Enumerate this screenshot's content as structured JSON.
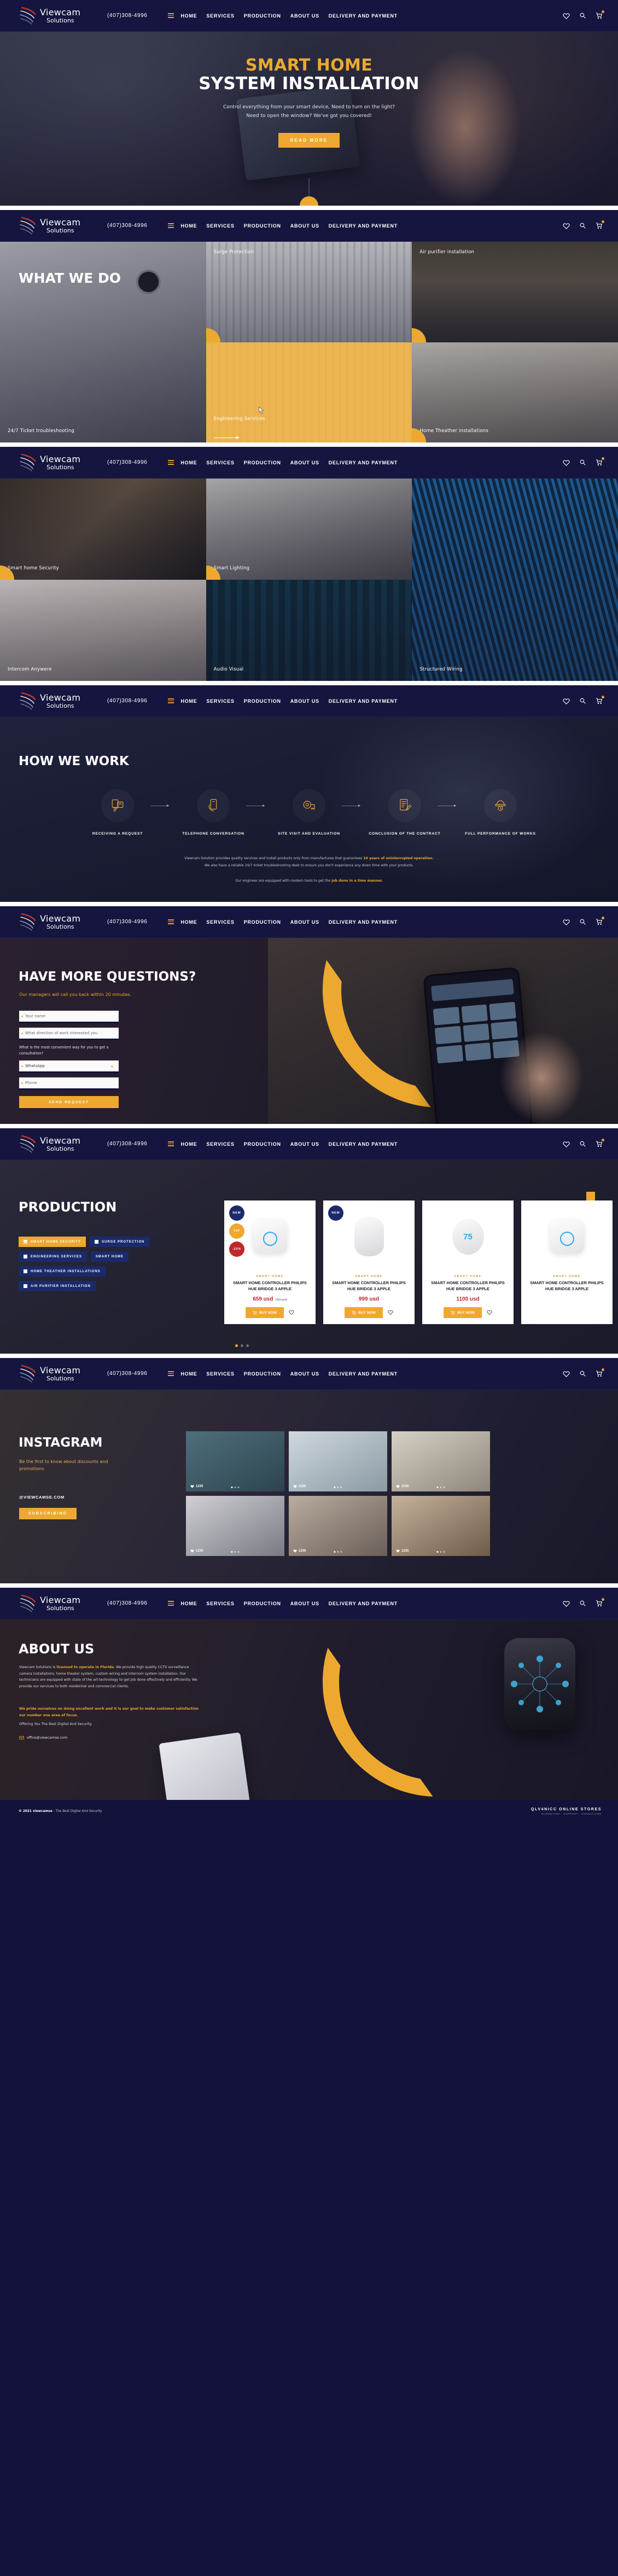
{
  "brand": {
    "name": "Viewcam",
    "tagline": "Solutions",
    "phone": "(407)308-4996"
  },
  "nav": {
    "links": [
      "HOME",
      "SERVICES",
      "PRODUCTION",
      "ABOUT US",
      "DELIVERY AND PAYMENT"
    ],
    "icons": [
      "heart-icon",
      "search-icon",
      "cart-icon"
    ]
  },
  "hero": {
    "title_accent": "SMART HOME",
    "title_main": "SYSTEM INSTALLATION",
    "sub_line1": "Control everything from your smart device, Need to turn on the light?",
    "sub_line2": "Need to open the window? We've got you covered!",
    "cta": "READ MORE"
  },
  "what_we_do": {
    "title": "WHAT WE DO",
    "tiles": [
      {
        "label": "24/7 Ticket troubleshooting",
        "active": false
      },
      {
        "label": "Surge Protection",
        "active": false
      },
      {
        "label": "Air purifier installation",
        "active": false
      },
      {
        "label": "Engineering Services",
        "active": true
      },
      {
        "label": "Home Theather installations",
        "active": false
      }
    ]
  },
  "gallery2": {
    "tiles": [
      {
        "label": "Smart home Security"
      },
      {
        "label": "Smart Lighting"
      },
      {
        "label": "Structured Wiring"
      },
      {
        "label": "Intercom Anywere"
      },
      {
        "label": "Audio Visual"
      }
    ]
  },
  "how_we_work": {
    "title": "HOW WE WORK",
    "steps": [
      {
        "label": "RECEIVING A REQUEST",
        "icon": "request-form-icon"
      },
      {
        "label": "TELEPHONE CONVERSATION",
        "icon": "phone-hand-icon"
      },
      {
        "label": "SITE VISIT AND EVALUATION",
        "icon": "tape-measure-icon"
      },
      {
        "label": "CONCLUSION OF THE CONTRACT",
        "icon": "contract-pen-icon"
      },
      {
        "label": "FULL PERFORMANCE OF WORKS",
        "icon": "engineer-icon"
      }
    ],
    "note1_a": "Viewcam Solution provides quality services and install products only from manufactures that guarantees ",
    "note1_hl": "10 years of uninterrupted operation.",
    "note2": "We also have a reliable 24/7 ticket troubleshooting desk to ensure you don't experiance any down time with your products.",
    "note3_a": "Our engineer are equipped with modern tools to get the ",
    "note3_hl": "job done in a time manner."
  },
  "questions": {
    "title": "HAVE MORE QUESTIONS?",
    "subtitle": "Our managers will call you back within 20 minutes.",
    "field_name_placeholder": "Your name",
    "field_direction_placeholder": "What direction of work interested you",
    "consult_question": "What is the most convenient way for you to get a consultation?",
    "select_value": "WhatsApp",
    "field_phone_placeholder": "Phone",
    "submit": "SEND REQUEST"
  },
  "production": {
    "title": "PRODUCTION",
    "filters": [
      {
        "label": "SMART HOME SECURITY",
        "checked": true
      },
      {
        "label": "SURGE PROTECTION",
        "checked": false
      },
      {
        "label": "ENGINEERING SERVICES",
        "checked": false
      },
      {
        "label": "SMART HOME",
        "checked": false
      },
      {
        "label": "HOME THEATHER INSTALLATIONS",
        "checked": false
      },
      {
        "label": "AIR PURIFIER INSTALLATION",
        "checked": false
      }
    ],
    "badges": [
      "NEW",
      "VIP",
      "-20%"
    ],
    "buy_label": "BUY NOW",
    "cards": [
      {
        "category": "SMART HOME",
        "name": "SMART HOME CONTROLLER PHILIPS HUE BRIDGE 3 APPLE",
        "price": "659 usd",
        "old_price": "750 usd",
        "badges": [
          "NEW",
          "VIP",
          "-20%"
        ],
        "device": "hub"
      },
      {
        "category": "SMART HOME",
        "name": "SMART HOME CONTROLLER PHILIPS HUE BRIDGE 3 APPLE",
        "price": "999 usd",
        "old_price": "",
        "badges": [
          "NEW"
        ],
        "device": "speaker"
      },
      {
        "category": "SMART HOME",
        "name": "SMART HOME CONTROLLER PHILIPS HUE BRIDGE 3 APPLE",
        "price": "1100 usd",
        "old_price": "",
        "badges": [],
        "device": "nest"
      },
      {
        "category": "SMART HOME",
        "name": "SMART HOME CONTROLLER PHILIPS HUE BRIDGE 3 APPLE",
        "price": "",
        "old_price": "",
        "badges": [],
        "device": "hub"
      }
    ]
  },
  "instagram": {
    "title": "INSTAGRAM",
    "subtitle": "Be the first to know about discounts and promotions",
    "handle": "@VIEWCAMSE.COM",
    "cta": "SUBSCRIBING",
    "posts": [
      {
        "likes": "1235"
      },
      {
        "likes": "1235"
      },
      {
        "likes": "1235"
      },
      {
        "likes": "1235"
      },
      {
        "likes": "1235"
      },
      {
        "likes": "1235"
      }
    ]
  },
  "about": {
    "title": "ABOUT US",
    "p1_a": "Viewcam Solutions is ",
    "p1_hl": "licensed to operate in Florida",
    "p1_b": ". We provide high quality CCTV surveillance camera installations, home theater system, custom wiring and intercom system installation. Our technicians are equipped with state of the art technology to get job done effectively and efficiently. We provide our services to both residential and commercial clients.",
    "p2": "We pride ourselves on doing excellent work and it is our goal to make customer satisfaction our number one area of focus.",
    "p3": "Offering You The Best Digital And Security.",
    "email": "office@viewcamse.com"
  },
  "footer": {
    "copyright_a": "© 2021 viewcamse",
    "copyright_b": " - The Best Digital And Security",
    "brand_line1": "QLV4NICC ONLINE STORES",
    "brand_line2": "MARKETING · SUPPORT · CONSULTING"
  }
}
